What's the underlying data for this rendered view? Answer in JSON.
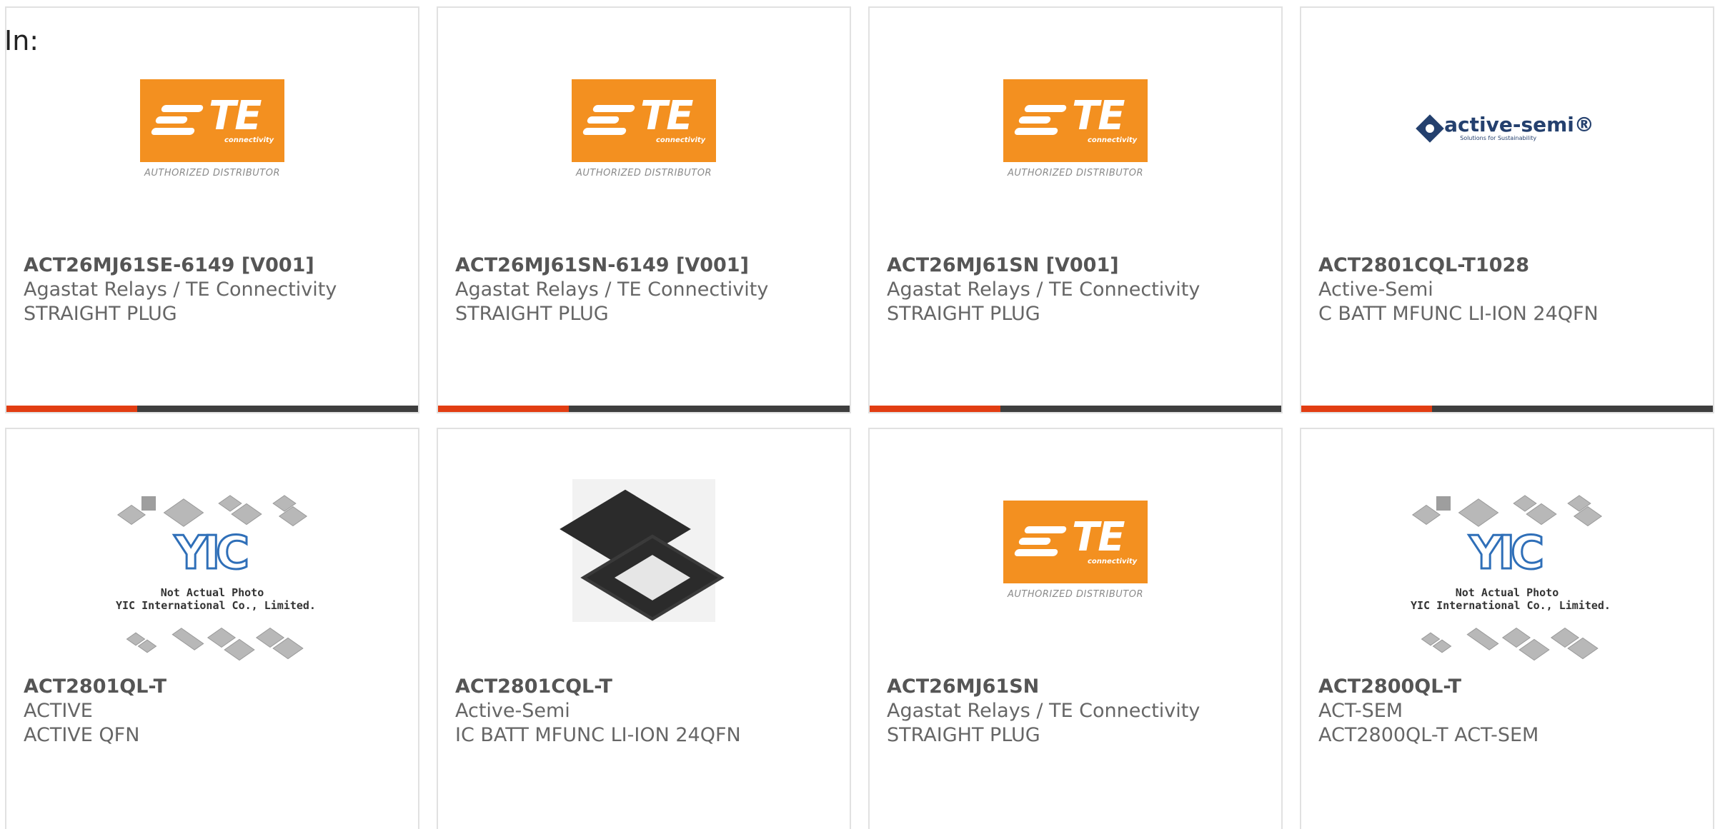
{
  "filter": {
    "label": "In:"
  },
  "products": [
    {
      "part_number": "ACT26MJ61SE-6149 [V001]",
      "manufacturer": "Agastat Relays / TE Connectivity",
      "description": "STRAIGHT PLUG",
      "image": "te-connectivity-logo",
      "logo_text": "TE",
      "logo_subtext": "connectivity",
      "logo_caption": "AUTHORIZED DISTRIBUTOR",
      "has_bar": true
    },
    {
      "part_number": "ACT26MJ61SN-6149 [V001]",
      "manufacturer": "Agastat Relays / TE Connectivity",
      "description": "STRAIGHT PLUG",
      "image": "te-connectivity-logo",
      "logo_text": "TE",
      "logo_subtext": "connectivity",
      "logo_caption": "AUTHORIZED DISTRIBUTOR",
      "has_bar": true
    },
    {
      "part_number": "ACT26MJ61SN [V001]",
      "manufacturer": "Agastat Relays / TE Connectivity",
      "description": "STRAIGHT PLUG",
      "image": "te-connectivity-logo",
      "logo_text": "TE",
      "logo_subtext": "connectivity",
      "logo_caption": "AUTHORIZED DISTRIBUTOR",
      "has_bar": true
    },
    {
      "part_number": "ACT2801CQL-T1028",
      "manufacturer": "Active-Semi",
      "description": "C BATT MFUNC LI-ION 24QFN",
      "image": "active-semi-logo",
      "logo_text": "active-semi®",
      "logo_subtext": "Solutions for Sustainability",
      "has_bar": true
    },
    {
      "part_number": "ACT2801QL-T",
      "manufacturer": "ACTIVE",
      "description": "ACTIVE QFN",
      "image": "yic-placeholder",
      "logo_text": "YIC",
      "logo_caption_1": "Not Actual Photo",
      "logo_caption_2": "YIC International Co., Limited."
    },
    {
      "part_number": "ACT2801CQL-T",
      "manufacturer": "Active-Semi",
      "description": "IC BATT MFUNC LI-ION 24QFN",
      "image": "qfn-chip-photo"
    },
    {
      "part_number": "ACT26MJ61SN",
      "manufacturer": "Agastat Relays / TE Connectivity",
      "description": "STRAIGHT PLUG",
      "image": "te-connectivity-logo",
      "logo_text": "TE",
      "logo_subtext": "connectivity",
      "logo_caption": "AUTHORIZED DISTRIBUTOR"
    },
    {
      "part_number": "ACT2800QL-T",
      "manufacturer": "ACT-SEM",
      "description": "ACT2800QL-T ACT-SEM",
      "image": "yic-placeholder",
      "logo_text": "YIC",
      "logo_caption_1": "Not Actual Photo",
      "logo_caption_2": "YIC International Co., Limited."
    }
  ],
  "colors": {
    "bar_accent": "#e23d12",
    "bar_base": "#3e3e3e",
    "te_orange": "#f39020",
    "active_semi_blue": "#24406e",
    "yic_blue": "#2f6fb8",
    "card_border": "#e1e1e1"
  }
}
